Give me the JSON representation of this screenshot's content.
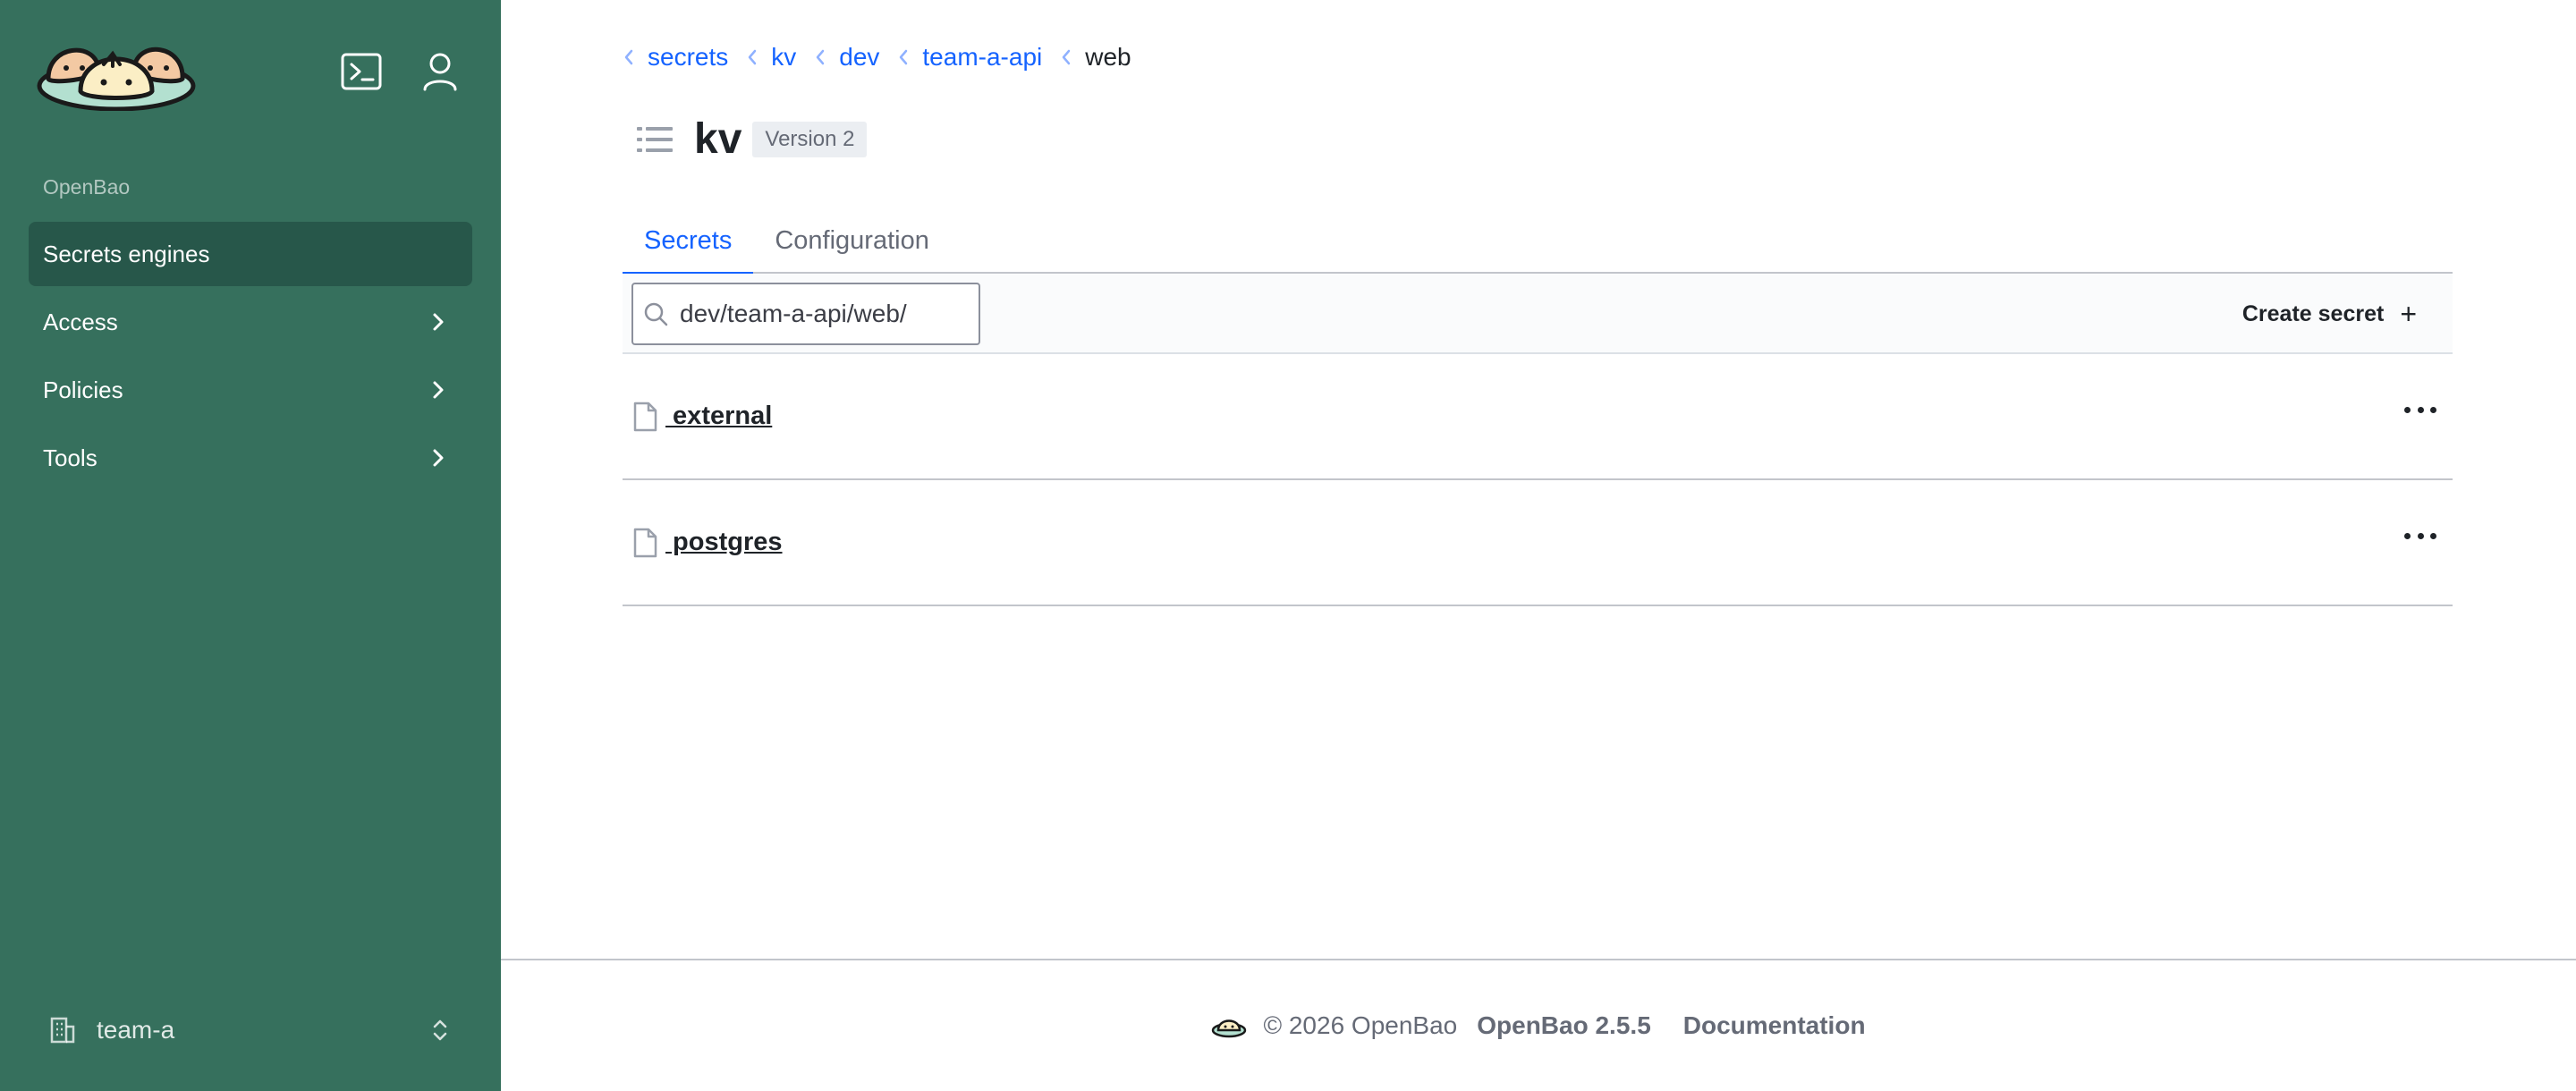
{
  "sidebar": {
    "section_label": "OpenBao",
    "items": [
      {
        "label": "Secrets engines",
        "active": true
      },
      {
        "label": "Access"
      },
      {
        "label": "Policies"
      },
      {
        "label": "Tools"
      }
    ],
    "namespace": "team-a",
    "icons": [
      "terminal-icon",
      "user-icon",
      "chevron-right-icon",
      "building-icon",
      "chevron-up-down-icon"
    ]
  },
  "breadcrumb": {
    "items": [
      "secrets",
      "kv",
      "dev",
      "team-a-api"
    ],
    "current": "web"
  },
  "header": {
    "title": "kv",
    "version_badge": "Version 2"
  },
  "tabs": [
    {
      "label": "Secrets",
      "active": true
    },
    {
      "label": "Configuration"
    }
  ],
  "toolbar": {
    "search_value": "dev/team-a-api/web/",
    "create_label": "Create secret"
  },
  "secrets": [
    {
      "name": " external"
    },
    {
      "name": " postgres"
    }
  ],
  "footer": {
    "copyright": "© 2026 OpenBao",
    "version": "OpenBao 2.5.5",
    "docs_link": "Documentation"
  },
  "colors": {
    "sidebar_bg": "#36705d",
    "sidebar_active": "#27574a",
    "link_blue": "#1563ff"
  }
}
